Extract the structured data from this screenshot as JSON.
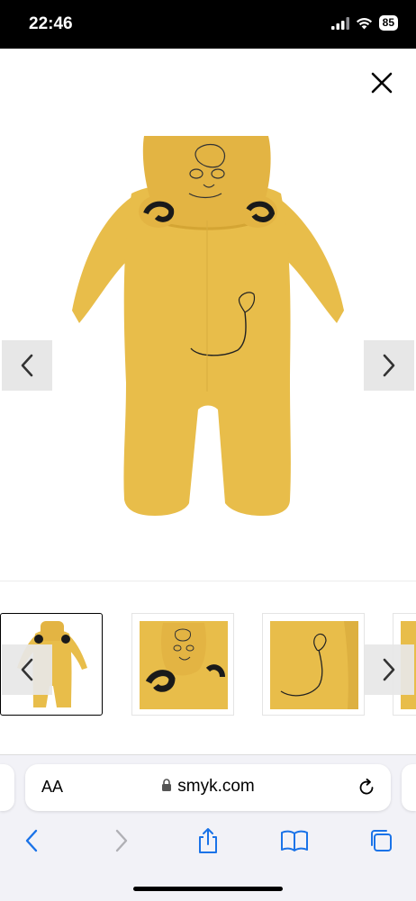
{
  "status_bar": {
    "time": "22:46",
    "battery": "85"
  },
  "product": {
    "main_image_alt": "Yellow plush lion onesie with hood and ears",
    "thumbnails": [
      {
        "alt": "Full onesie back view"
      },
      {
        "alt": "Hood close-up with lion face"
      },
      {
        "alt": "Tail embroidery close-up"
      },
      {
        "alt": "Partial view"
      }
    ]
  },
  "browser": {
    "text_size_label": "AA",
    "url": "smyk.com"
  },
  "colors": {
    "fabric": "#e8bd4a",
    "fabric_shadow": "#d4a534",
    "accent_blue": "#1a73e8"
  },
  "icons": {
    "close": "close-icon",
    "prev": "chevron-left-icon",
    "next": "chevron-right-icon",
    "lock": "lock-icon",
    "reload": "reload-icon",
    "share": "share-icon",
    "bookmarks": "book-icon",
    "tabs": "tabs-icon"
  }
}
